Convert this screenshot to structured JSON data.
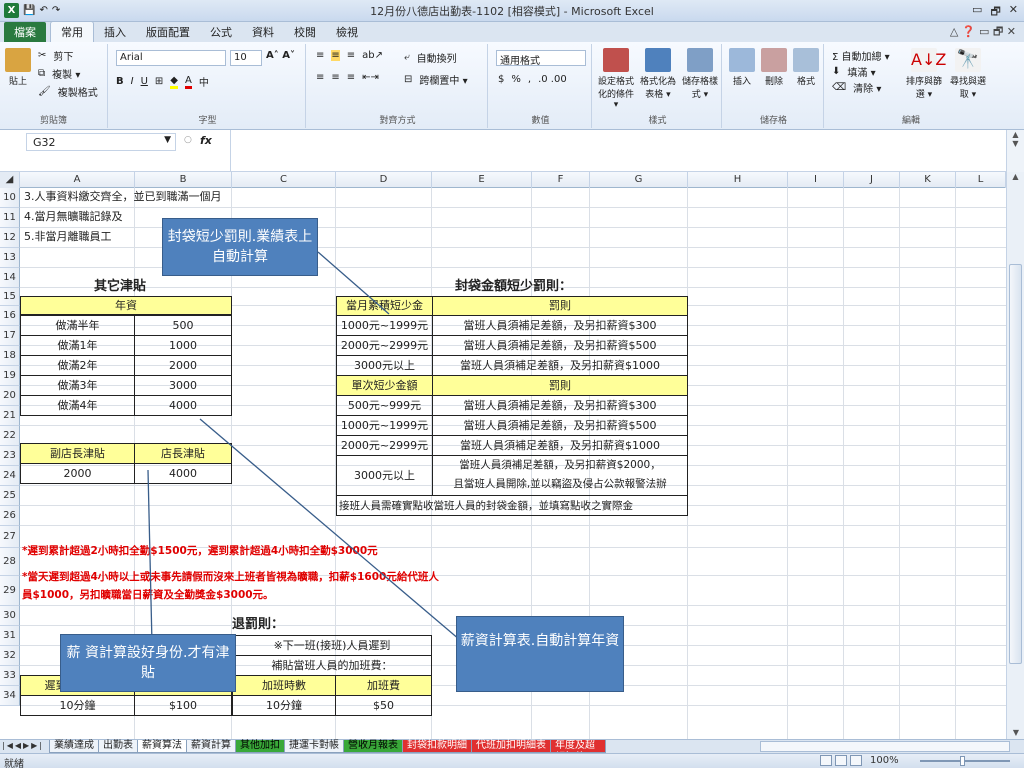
{
  "window": {
    "title": "12月份八德店出勤表-1102 [相容模式] - Microsoft Excel",
    "min": "▭",
    "restore": "🗗",
    "close": "✕"
  },
  "tabs": [
    "檔案",
    "常用",
    "插入",
    "版面配置",
    "公式",
    "資料",
    "校閱",
    "檢視"
  ],
  "ribbon": {
    "clipboard": {
      "paste": "貼上",
      "cut": "剪下",
      "copy": "複製 ▾",
      "format_painter": "複製格式",
      "label": "剪貼簿"
    },
    "font": {
      "name": "Arial",
      "size": "10",
      "label": "字型"
    },
    "align": {
      "wrap": "自動換列",
      "merge": "跨欄置中 ▾",
      "label": "對齊方式"
    },
    "number": {
      "format": "通用格式",
      "label": "數值"
    },
    "styles": {
      "cond": "設定格式化的條件 ▾",
      "table": "格式化為表格 ▾",
      "cell": "儲存格樣式 ▾",
      "label": "樣式"
    },
    "cells": {
      "insert": "插入",
      "delete": "刪除",
      "format": "格式",
      "label": "儲存格"
    },
    "editing": {
      "autosum": "Σ 自動加總 ▾",
      "fill": "填滿 ▾",
      "clear": "清除 ▾",
      "sort": "排序與篩選 ▾",
      "find": "尋找與選取 ▾",
      "label": "編輯"
    }
  },
  "formula_bar": {
    "name_box": "G32",
    "fx": "fx"
  },
  "columns": [
    "A",
    "B",
    "C",
    "D",
    "E",
    "F",
    "G",
    "H",
    "I",
    "J",
    "K",
    "L"
  ],
  "rows": [
    "10",
    "11",
    "12",
    "13",
    "14",
    "15",
    "16",
    "17",
    "18",
    "19",
    "20",
    "21",
    "22",
    "23",
    "24",
    "25",
    "26",
    "27",
    "28",
    "29",
    "30",
    "31",
    "32",
    "33",
    "34"
  ],
  "notes": {
    "r10": "3.人事資料繳交齊全，並已到職滿一個月",
    "r11": "4.當月無曠職記錄及",
    "r12": "5.非當月離職員工"
  },
  "allowance": {
    "title": "其它津貼",
    "header": "年資",
    "items": [
      {
        "label": "做滿半年",
        "value": "500"
      },
      {
        "label": "做滿1年",
        "value": "1000"
      },
      {
        "label": "做滿2年",
        "value": "2000"
      },
      {
        "label": "做滿3年",
        "value": "3000"
      },
      {
        "label": "做滿4年",
        "value": "4000"
      }
    ],
    "vice_label": "副店長津貼",
    "vice_value": "2000",
    "mgr_label": "店長津貼",
    "mgr_value": "4000"
  },
  "penalty": {
    "title": "封袋金額短少罰則：",
    "h1": "當月累積短少金",
    "h1b": "罰則",
    "rows1": [
      {
        "range": "1000元~1999元",
        "rule": "當班人員須補足差額，及另扣薪資$300"
      },
      {
        "range": "2000元~2999元",
        "rule": "當班人員須補足差額，及另扣薪資$500"
      },
      {
        "range": "3000元以上",
        "rule": "當班人員須補足差額，及另扣薪資$1000"
      }
    ],
    "h2": "單次短少金額",
    "h2b": "罰則",
    "rows2": [
      {
        "range": "500元~999元",
        "rule": "當班人員須補足差額，及另扣薪資$300"
      },
      {
        "range": "1000元~1999元",
        "rule": "當班人員須補足差額，及另扣薪資$500"
      },
      {
        "range": "2000元~2999元",
        "rule": "當班人員須補足差額，及另扣薪資$1000"
      }
    ],
    "last_range": "3000元以上",
    "last_rule1": "當班人員須補足差額，及另扣薪資$2000，",
    "last_rule2": "且當班人員開除,並以竊盜及侵占公款報警法辦",
    "footer": "接班人員需確實點收當班人員的封袋金額，並填寫點收之實際金"
  },
  "late": {
    "r27": "*遲到累計超過2小時扣全勤$1500元，遲到累計超過4小時扣全勤$3000元",
    "r28a": "*當天遲到超過4小時以上或未事先請假而沒來上班者皆視為曠職，扣薪$1600元給代班人",
    "r28b": "員$1000，另扣曠職當日薪資及全勤獎金$3000元。",
    "title_frag": "退罰則：",
    "r31": "※下一班(接班)人員遲到",
    "r32": "補貼當班人員的加班費：",
    "r33": [
      "遲到早退分數",
      "罰金",
      "加班時數",
      "加班費"
    ],
    "r34": [
      "10分鐘",
      "$100",
      "10分鐘",
      "$50"
    ]
  },
  "callouts": {
    "c1": "封袋短少罰則.業績表上自動計算",
    "c2": "薪 資計算設好身份.才有津貼",
    "c3": "薪資計算表.自動計算年資"
  },
  "sheets": [
    "業績達成",
    "出勤表",
    "薪資算法",
    "薪資計算",
    "其他加扣",
    "捷運卡對帳",
    "營收月報表",
    "封袋扣款明細",
    "代班加扣明細表",
    "年度及超額扣款"
  ],
  "status": {
    "ready": "就緒",
    "zoom": "100%"
  },
  "colors": {
    "yellow": "#ffff99",
    "callout": "#4f81bd",
    "red": "#e00000",
    "file_tab": "#2a7a3f"
  }
}
